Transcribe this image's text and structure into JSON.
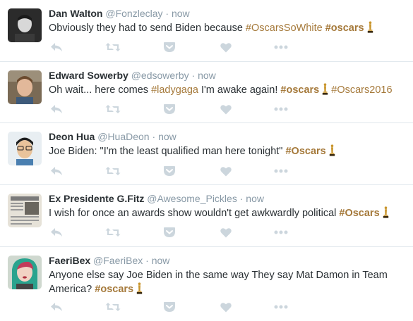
{
  "tweets": [
    {
      "name": "Dan Walton",
      "handle": "@Fonzleclay",
      "time": "now",
      "parts": [
        {
          "text": "Obviously they had to send Biden because ",
          "type": "plain"
        },
        {
          "text": "#OscarsSoWhite",
          "type": "tag"
        },
        {
          "text": " ",
          "type": "plain"
        },
        {
          "text": "#oscars",
          "type": "tag-bold"
        }
      ],
      "oscar_icon": true
    },
    {
      "name": "Edward Sowerby",
      "handle": "@edsowerby",
      "time": "now",
      "parts": [
        {
          "text": "Oh wait... here comes ",
          "type": "plain"
        },
        {
          "text": "#ladygaga",
          "type": "tag"
        },
        {
          "text": " I'm awake again! ",
          "type": "plain"
        },
        {
          "text": "#oscars",
          "type": "tag-bold"
        },
        {
          "text": "OSCAR",
          "type": "icon"
        },
        {
          "text": " ",
          "type": "plain"
        },
        {
          "text": "#Oscars2016",
          "type": "tag"
        }
      ],
      "oscar_icon": false
    },
    {
      "name": "Deon Hua",
      "handle": "@HuaDeon",
      "time": "now",
      "parts": [
        {
          "text": "Joe Biden: \"I'm the least qualified man here tonight\" ",
          "type": "plain"
        },
        {
          "text": "#Oscars",
          "type": "tag-bold"
        }
      ],
      "oscar_icon": true
    },
    {
      "name": "Ex Presidente G.Fitz",
      "handle": "@Awesome_Pickles",
      "time": "now",
      "parts": [
        {
          "text": "I wish for once an awards show wouldn't get awkwardly political ",
          "type": "plain"
        },
        {
          "text": "#Oscars",
          "type": "tag-bold"
        }
      ],
      "oscar_icon": true
    },
    {
      "name": "FaeriBex",
      "handle": "@FaeriBex",
      "time": "now",
      "parts": [
        {
          "text": "Anyone else say Joe Biden in the same way They say Mat Damon in Team America? ",
          "type": "plain"
        },
        {
          "text": "#oscars",
          "type": "tag-bold"
        }
      ],
      "oscar_icon": true
    }
  ],
  "separator": "·",
  "icons": {
    "reply": "reply-icon",
    "retweet": "retweet-icon",
    "save": "pocket-icon",
    "like": "heart-icon",
    "more": "more-icon",
    "hashtag_emoji": "oscar-statuette-icon"
  },
  "colors": {
    "name": "#292f33",
    "meta": "#8899a6",
    "hashtag": "#a5793a",
    "action_icon": "#ccd6dd",
    "divider": "#e1e8ed",
    "oscar_gold": "#c9962e"
  }
}
